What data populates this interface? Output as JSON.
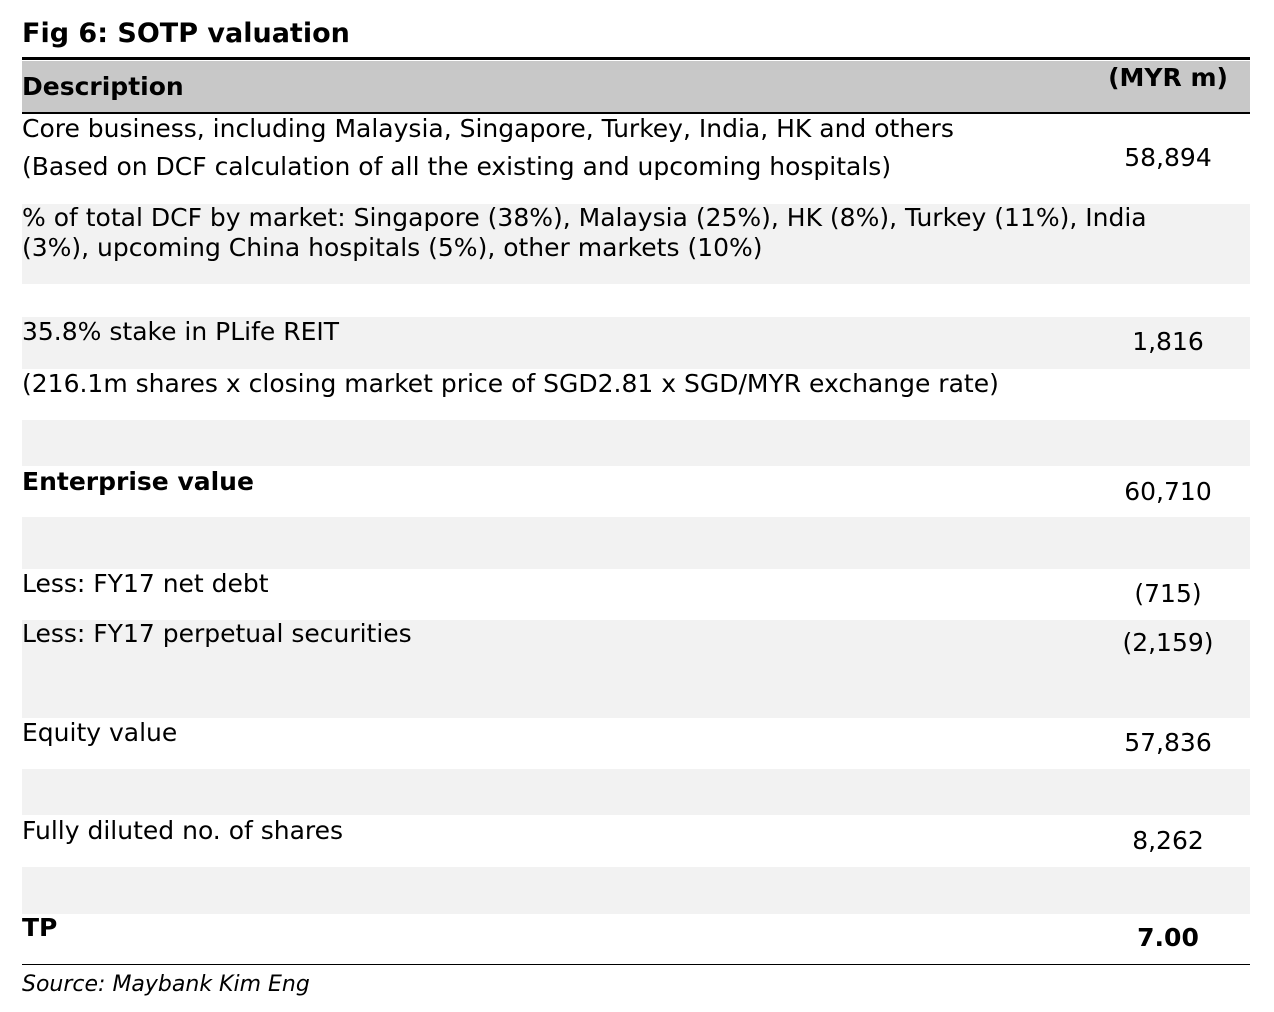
{
  "title": "Fig 6: SOTP valuation",
  "table": {
    "header": {
      "description": "Description",
      "unit": "(MYR m)"
    },
    "rows": [
      {
        "label_line1": "Core business, including Malaysia, Singapore, Turkey, India, HK and others",
        "label_line2": "(Based on DCF calculation of all the existing and upcoming hospitals)",
        "value": "58,894"
      },
      {
        "label_line1": "% of total DCF by market: Singapore (38%), Malaysia (25%), HK (8%), Turkey (11%), India",
        "label_line2": "(3%), upcoming China hospitals (5%), other markets (10%)"
      },
      {
        "label_line1": "35.8% stake in PLife REIT",
        "label_line2": "(216.1m shares x closing market price of SGD2.81 x SGD/MYR exchange rate)",
        "value": "1,816"
      },
      {
        "label": "Enterprise value",
        "value": "60,710"
      },
      {
        "label": "Less: FY17 net debt",
        "value": "(715)"
      },
      {
        "label": "Less: FY17 perpetual securities",
        "value": "(2,159)"
      },
      {
        "label": "Equity value",
        "value": "57,836"
      },
      {
        "label": "Fully diluted no. of shares",
        "value": "8,262"
      },
      {
        "label": "TP",
        "value": "7.00"
      }
    ]
  },
  "source": "Source: Maybank Kim Eng"
}
